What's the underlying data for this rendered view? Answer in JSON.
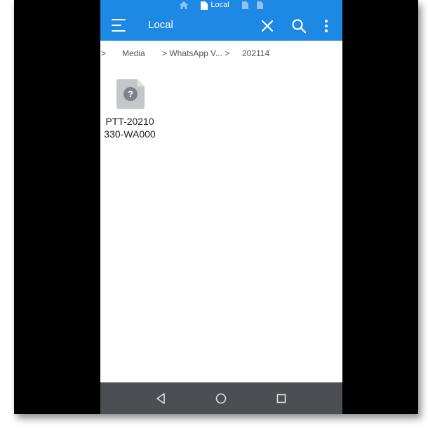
{
  "status_tabs": {
    "active_label": "Local",
    "icons": [
      "home-icon",
      "document-icon",
      "document-icon",
      "document-icon"
    ]
  },
  "appbar": {
    "title": "Local",
    "icons": [
      "menu-icon",
      "close-icon",
      "search-icon",
      "more-vert-icon"
    ]
  },
  "breadcrumb": {
    "items": [
      ">",
      "Media",
      "> WhatsApp V... >",
      "202114"
    ]
  },
  "files": [
    {
      "name_line1": "PTT-20210",
      "name_line2": "330-WA000",
      "icon": "unknown-file-icon"
    }
  ],
  "navbar": {
    "icons": [
      "back-icon",
      "home-circle-icon",
      "recents-icon"
    ]
  },
  "colors": {
    "accent": "#1e88e5",
    "navbar": "#4b4f54",
    "frame": "#000000",
    "file_icon": "#c4c6c9"
  }
}
